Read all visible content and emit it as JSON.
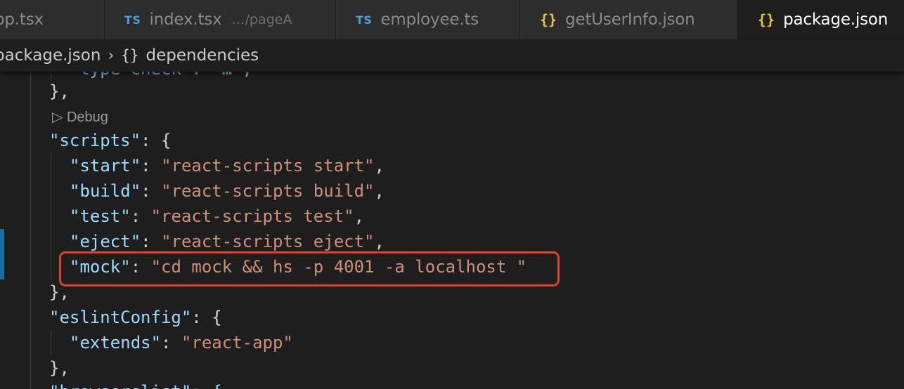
{
  "tabs": [
    {
      "label": "pp.tsx",
      "icon": "",
      "active": false
    },
    {
      "label": "index.tsx",
      "icon": "TS",
      "description": "…/pageA",
      "active": false
    },
    {
      "label": "employee.ts",
      "icon": "TS",
      "active": false
    },
    {
      "label": "getUserInfo.json",
      "icon": "{}",
      "active": false
    },
    {
      "label": "package.json",
      "icon": "{}",
      "active": true
    }
  ],
  "breadcrumb": {
    "file": "package.json",
    "separator": "›",
    "icon": "{}",
    "symbol": "dependencies"
  },
  "editor": {
    "codelens": "▷ Debug",
    "lines": [
      {
        "tokens": [
          {
            "t": "},",
            "c": "punc"
          }
        ]
      },
      {
        "tokens": [
          {
            "t": "\"scripts\"",
            "c": "key"
          },
          {
            "t": ": {",
            "c": "punc"
          }
        ]
      },
      {
        "tokens": [
          {
            "t": "\"start\"",
            "c": "key"
          },
          {
            "t": ": ",
            "c": "punc"
          },
          {
            "t": "\"react-scripts start\"",
            "c": "str"
          },
          {
            "t": ",",
            "c": "punc"
          }
        ]
      },
      {
        "tokens": [
          {
            "t": "\"build\"",
            "c": "key"
          },
          {
            "t": ": ",
            "c": "punc"
          },
          {
            "t": "\"react-scripts build\"",
            "c": "str"
          },
          {
            "t": ",",
            "c": "punc"
          }
        ]
      },
      {
        "tokens": [
          {
            "t": "\"test\"",
            "c": "key"
          },
          {
            "t": ": ",
            "c": "punc"
          },
          {
            "t": "\"react-scripts test\"",
            "c": "str"
          },
          {
            "t": ",",
            "c": "punc"
          }
        ]
      },
      {
        "tokens": [
          {
            "t": "\"eject\"",
            "c": "key"
          },
          {
            "t": ": ",
            "c": "punc"
          },
          {
            "t": "\"react-scripts eject\"",
            "c": "str"
          },
          {
            "t": ",",
            "c": "punc"
          }
        ]
      },
      {
        "tokens": [
          {
            "t": "\"mock\"",
            "c": "key"
          },
          {
            "t": ": ",
            "c": "punc"
          },
          {
            "t": "\"cd mock && hs -p 4001 -a localhost \"",
            "c": "str"
          }
        ]
      },
      {
        "tokens": [
          {
            "t": "},",
            "c": "punc"
          }
        ]
      },
      {
        "tokens": [
          {
            "t": "\"eslintConfig\"",
            "c": "key"
          },
          {
            "t": ": {",
            "c": "punc"
          }
        ]
      },
      {
        "tokens": [
          {
            "t": "\"extends\"",
            "c": "key"
          },
          {
            "t": ": ",
            "c": "punc"
          },
          {
            "t": "\"react-app\"",
            "c": "str"
          }
        ]
      },
      {
        "tokens": [
          {
            "t": "},",
            "c": "punc"
          }
        ]
      }
    ]
  },
  "colors": {
    "editor_bg": "#1e1e1e",
    "tab_inactive_bg": "#2d2d2d",
    "json_key": "#9cdcfe",
    "json_string": "#ce9178",
    "ts_icon": "#4e9fd8",
    "json_icon": "#e6c43e",
    "highlight_box": "#e2412f",
    "gutter_marker": "#1b6fa0"
  }
}
